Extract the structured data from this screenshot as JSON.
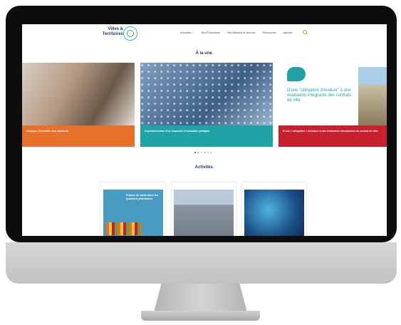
{
  "site": {
    "logo_line1": "Villes &",
    "logo_line2": "Territoires"
  },
  "nav": {
    "items": [
      "Actualités ⌄",
      "Nos Productions",
      "Nos Missions et services",
      "Ressources",
      "Agenda"
    ]
  },
  "carousel": {
    "title": "À la une",
    "slides": [
      {
        "caption": "ologique | Connaître des habitants",
        "color": "#e8702a"
      },
      {
        "caption": "Expérimentation d'un dispositif d'évaluation partagée",
        "color": "#1fa3a6"
      },
      {
        "caption": "D'une « obligation » d'évaluer à une évaluation structurante du contrat de ville",
        "color": "#c8202c",
        "image_text": "D'une \"obligation d'évaluer\" à une évaluation intégrante des contrats de ville"
      }
    ],
    "page_count": 6,
    "active_index": 0
  },
  "activities": {
    "title": "Activités",
    "cards": [
      {
        "image_text": "Enjeux de santé dans les quartiers prioritaires",
        "name": "sante"
      },
      {
        "image_text": "",
        "name": "quartier"
      },
      {
        "image_text": "",
        "name": "numerique"
      }
    ]
  },
  "colors": {
    "brand_blue": "#1e3a6e",
    "accent_teal": "#1fa3a6",
    "orange": "#e8702a",
    "red": "#c8202c"
  }
}
